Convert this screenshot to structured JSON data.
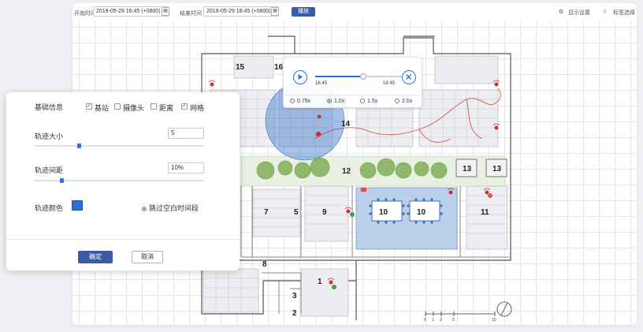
{
  "toolbar": {
    "start_label": "开始时间",
    "start_value": "2019-05-29 16:45 (+0800)",
    "end_label": "结束时间",
    "end_value": "2019-05-29 18:45 (+0800)",
    "play_label": "播放",
    "display_settings": "显示设置",
    "label_select": "标签选择"
  },
  "player": {
    "time_start": "16:45",
    "time_end": "18:45",
    "speeds": [
      "0.75x",
      "1.0x",
      "1.5x",
      "2.0x"
    ],
    "selected_speed": "1.0x",
    "progress": 0.55
  },
  "floorplan": {
    "rooms": [
      "15",
      "16",
      "14",
      "12",
      "13",
      "13",
      "7",
      "5",
      "9",
      "10",
      "10",
      "11",
      "8",
      "3",
      "1",
      "2"
    ],
    "scale_labels": [
      "0",
      "1",
      "2",
      "5",
      "10"
    ]
  },
  "panel": {
    "basic_info": "基础信息",
    "checkboxes": [
      {
        "label": "基站",
        "checked": true
      },
      {
        "label": "摄像头",
        "checked": false
      },
      {
        "label": "距离",
        "checked": false
      },
      {
        "label": "网格",
        "checked": true
      }
    ],
    "track_size_label": "轨迹大小",
    "track_size_value": "5",
    "track_size_level": 0.25,
    "track_spacing_label": "轨迹间距",
    "track_spacing_value": "10%",
    "track_spacing_level": 0.15,
    "track_color_label": "轨迹颜色",
    "track_color": "#2d6fd6",
    "skip_label": "跳过空白时间段",
    "skip_checked": true,
    "ok": "确定",
    "cancel": "取消"
  }
}
